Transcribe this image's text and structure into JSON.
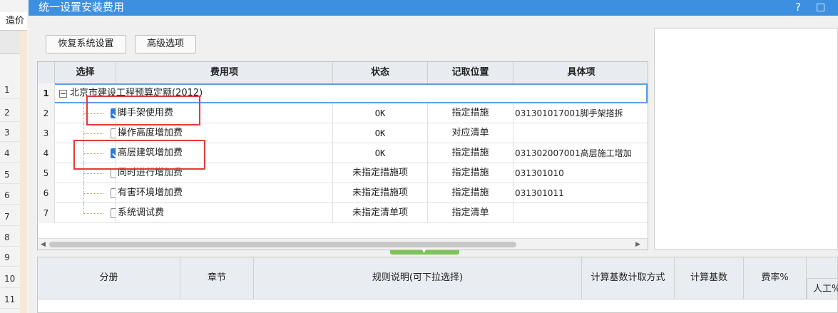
{
  "background": {
    "tab_label": "造价",
    "row_numbers": [
      "1",
      "2",
      "3",
      "4",
      "5",
      "6",
      "7",
      "8",
      "9",
      "10",
      "11"
    ]
  },
  "dialog": {
    "title": "统一设置安装费用",
    "help_glyph": "?",
    "maximize_glyph": "□",
    "buttons": {
      "restore": "恢复系统设置",
      "advanced": "高级选项"
    },
    "grid": {
      "headers": {
        "select": "选择",
        "item": "费用项",
        "status": "状态",
        "position": "记取位置",
        "detail": "具体项"
      },
      "group": {
        "num": "1",
        "expander": "−",
        "label": "北京市建设工程预算定额(2012)"
      },
      "rows": [
        {
          "num": "2",
          "checked": true,
          "name": "脚手架使用费",
          "status": "OK",
          "position": "指定措施",
          "detail": "031301017001脚手架搭拆"
        },
        {
          "num": "3",
          "checked": false,
          "name": "操作高度增加费",
          "status": "OK",
          "position": "对应清单",
          "detail": ""
        },
        {
          "num": "4",
          "checked": true,
          "name": "高层建筑增加费",
          "status": "OK",
          "position": "指定措施",
          "detail": "031302007001高层施工增加"
        },
        {
          "num": "5",
          "checked": false,
          "name": "同时进行增加费",
          "status": "未指定措施项",
          "position": "指定措施",
          "detail": "031301010"
        },
        {
          "num": "6",
          "checked": false,
          "name": "有害环境增加费",
          "status": "未指定措施项",
          "position": "指定措施",
          "detail": "031301011"
        },
        {
          "num": "7",
          "checked": false,
          "name": "系统调试费",
          "status": "未指定清单项",
          "position": "指定清单",
          "detail": ""
        }
      ]
    },
    "bottom_table": {
      "headers": {
        "volume": "分册",
        "chapter": "章节",
        "rule": "规则说明(可下拉选择)",
        "base_method": "计算基数计取方式",
        "base": "计算基数",
        "rate": "费率%",
        "labor": "人工%"
      }
    },
    "colors": {
      "titlebar": "#3d8fe0",
      "highlight": "#e03a3a",
      "checkbox": "#2c7be5",
      "splitter": "#7ec25a"
    }
  }
}
